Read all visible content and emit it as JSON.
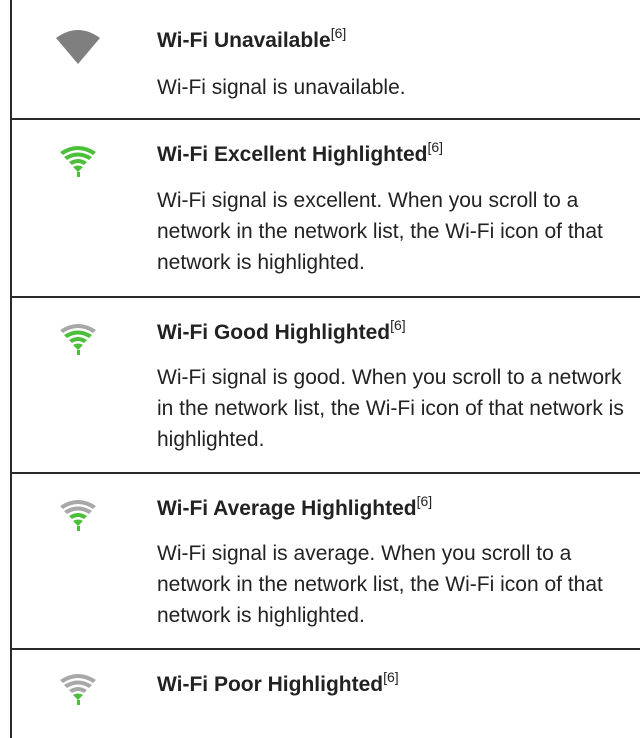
{
  "colors": {
    "unavailable_grey": "#7f7f7f",
    "highlight_green": "#4cbf3a",
    "inactive_grey": "#a8a8a8"
  },
  "rows": [
    {
      "icon": "wifi-unavailable-icon",
      "title": "Wi-Fi Unavailable",
      "ref": "[6]",
      "desc": "Wi-Fi signal is unavailable."
    },
    {
      "icon": "wifi-excellent-highlighted-icon",
      "title": "Wi-Fi Excellent Highlighted",
      "ref": "[6]",
      "desc": "Wi-Fi signal is excellent. When you scroll to a network in the network list, the Wi-Fi icon of that network is highlighted."
    },
    {
      "icon": "wifi-good-highlighted-icon",
      "title": "Wi-Fi Good Highlighted",
      "ref": "[6]",
      "desc": "Wi-Fi signal is good. When you scroll to a network in the network list, the Wi-Fi icon of that network is highlighted."
    },
    {
      "icon": "wifi-average-highlighted-icon",
      "title": "Wi-Fi Average Highlighted",
      "ref": "[6]",
      "desc": "Wi-Fi signal is average. When you scroll to a network in the network list, the Wi-Fi icon of that network is highlighted."
    },
    {
      "icon": "wifi-poor-highlighted-icon",
      "title": "Wi-Fi Poor Highlighted",
      "ref": "[6]",
      "desc": ""
    }
  ]
}
